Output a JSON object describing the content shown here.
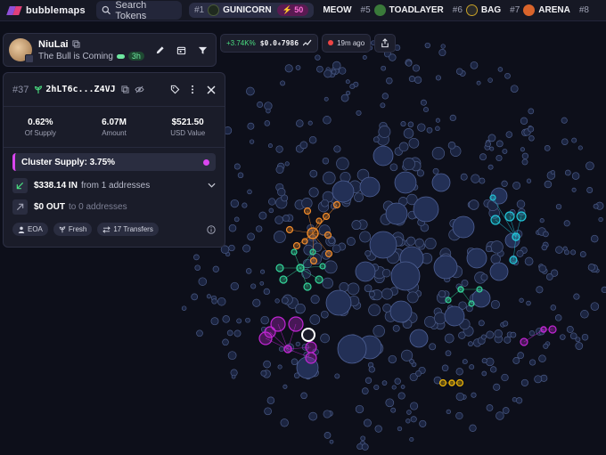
{
  "app": {
    "logo_text": "bubblemaps",
    "search_label": "Search Tokens"
  },
  "ticker": [
    {
      "rank": "#1",
      "name": "GUNICORN",
      "icon_color": "#1f2a1f",
      "active": true,
      "badge": "50"
    },
    {
      "rank": "",
      "name": "MEOW",
      "icon_color": "",
      "active": false
    },
    {
      "rank": "#5",
      "name": "TOADLAYER",
      "icon_color": "#3a7a3a",
      "active": false
    },
    {
      "rank": "#6",
      "name": "BAG",
      "icon_color": "#2a2a2a",
      "active": false
    },
    {
      "rank": "#7",
      "name": "ARENA",
      "icon_color": "#d9642b",
      "active": false
    },
    {
      "rank": "#8",
      "name": "",
      "icon_color": "",
      "active": false
    }
  ],
  "user": {
    "name": "NiuLai",
    "subtitle": "The Bull is Coming",
    "age": "3h"
  },
  "token_chips": {
    "change": "+3.74K%",
    "price": "$0.0₄7986",
    "updated": "19m ago"
  },
  "holder": {
    "rank": "#37",
    "address": "2hLT6c...Z4VJ",
    "stats": [
      {
        "value": "0.62%",
        "label": "Of Supply"
      },
      {
        "value": "6.07M",
        "label": "Amount"
      },
      {
        "value": "$521.50",
        "label": "USD Value"
      }
    ],
    "cluster_supply": "Cluster Supply: 3.75%",
    "in_amount": "$338.14 IN",
    "in_source": "from 1 addresses",
    "out_amount": "$0 OUT",
    "out_source": "to 0 addresses",
    "tags": [
      "EOA",
      "Fresh",
      "17 Transfers"
    ]
  },
  "colors": {
    "accent_pink": "#d946ef",
    "accent_green": "#4ade80",
    "bubble_base": "#1f2a4a",
    "cluster_orange": "#f08a2a",
    "cluster_green": "#34d399",
    "cluster_cyan": "#22c5d8",
    "cluster_purple": "#c026d3",
    "cluster_yellow": "#eab308"
  }
}
